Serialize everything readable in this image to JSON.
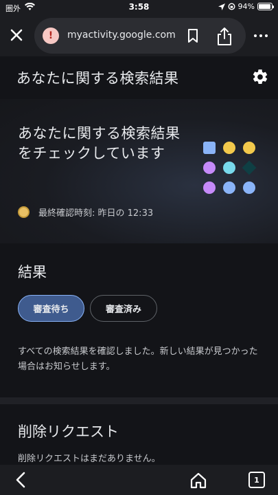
{
  "status_bar": {
    "carrier": "圏外",
    "time": "3:58",
    "battery_percent": "94%",
    "battery_level": 0.94
  },
  "browser": {
    "url": "myactivity.google.com",
    "icons": [
      "close-icon",
      "info-icon",
      "bookmark-icon",
      "share-icon",
      "more-icon"
    ]
  },
  "page": {
    "title": "あなたに関する検索結果",
    "settings_icon": "gear-icon"
  },
  "hero": {
    "title": "あなたに関する検索結果をチェックしています",
    "status_text": "最終確認時刻: 昨日の 12:33",
    "status_dot_color": "#e8c065",
    "dots": [
      {
        "shape": "square",
        "color": "#8ab4f8"
      },
      {
        "shape": "circle",
        "color": "#f2c94c"
      },
      {
        "shape": "circle",
        "color": "#f2c94c"
      },
      {
        "shape": "circle",
        "color": "#c58af9"
      },
      {
        "shape": "circle",
        "color": "#78d9ec"
      },
      {
        "shape": "diamond",
        "color": "#0f3f44"
      },
      {
        "shape": "circle",
        "color": "#c58af9"
      },
      {
        "shape": "circle",
        "color": "#8ab4f8"
      },
      {
        "shape": "circle",
        "color": "#8ab4f8"
      }
    ]
  },
  "results": {
    "heading": "結果",
    "tabs": [
      {
        "label": "審査待ち",
        "selected": true
      },
      {
        "label": "審査済み",
        "selected": false
      }
    ],
    "message": "すべての検索結果を確認しました。新しい結果が見つかった場合はお知らせします。"
  },
  "removal": {
    "heading": "削除リクエスト",
    "message": "削除リクエストはまだありません。"
  },
  "bottom_nav": {
    "tab_count": "1",
    "icons": [
      "back-icon",
      "home-icon",
      "tabs-icon"
    ]
  },
  "colors": {
    "background": "#131418",
    "accent": "#8ab4f8",
    "selected_chip": "#3f5b8e"
  }
}
